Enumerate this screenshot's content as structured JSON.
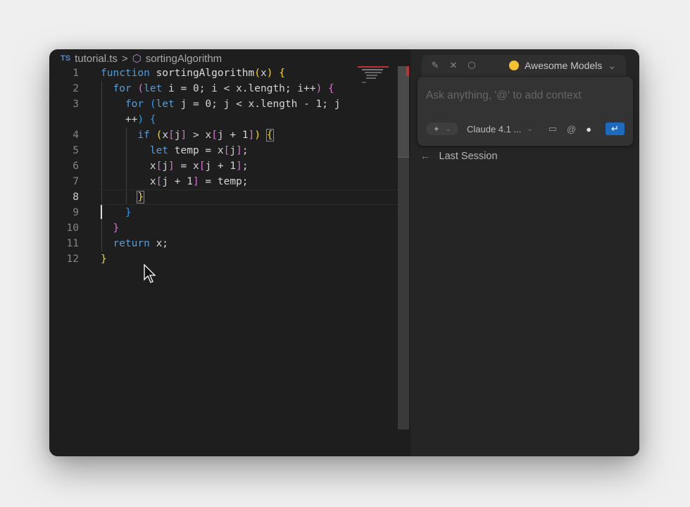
{
  "breadcrumb": {
    "lang_badge": "TS",
    "file": "tutorial.ts",
    "separator": ">",
    "symbol": "sortingAlgorithm"
  },
  "editor": {
    "current_line": 8,
    "lines": [
      {
        "n": "1",
        "tokens": [
          [
            "function ",
            "kw"
          ],
          [
            "sortingAlgorithm",
            "fn"
          ],
          [
            "(",
            "b1"
          ],
          [
            "x",
            ""
          ],
          [
            ")",
            "b1"
          ],
          [
            " ",
            ""
          ],
          [
            "{",
            "b1"
          ]
        ]
      },
      {
        "n": "2",
        "tokens": [
          [
            "  ",
            ""
          ],
          [
            "for ",
            "kw"
          ],
          [
            "(",
            "b2"
          ],
          [
            "let ",
            "kw"
          ],
          [
            "i = 0; i < x.length; i++",
            ""
          ],
          [
            ")",
            "b2"
          ],
          [
            " ",
            ""
          ],
          [
            "{",
            "b2"
          ]
        ]
      },
      {
        "n": "3",
        "tokens": [
          [
            "    ",
            ""
          ],
          [
            "for ",
            "kw"
          ],
          [
            "(",
            "b3"
          ],
          [
            "let ",
            "kw"
          ],
          [
            "j = 0; j < x.length - 1; j",
            ""
          ]
        ]
      },
      {
        "n": "",
        "tokens": [
          [
            "    ++",
            ""
          ],
          [
            ")",
            "b3"
          ],
          [
            " ",
            ""
          ],
          [
            "{",
            "b3"
          ]
        ]
      },
      {
        "n": "4",
        "tokens": [
          [
            "      ",
            ""
          ],
          [
            "if ",
            "kw"
          ],
          [
            "(",
            "b1"
          ],
          [
            "x",
            ""
          ],
          [
            "[",
            "b2"
          ],
          [
            "j",
            ""
          ],
          [
            "]",
            "b2"
          ],
          [
            " > x",
            ""
          ],
          [
            "[",
            "b2"
          ],
          [
            "j + 1",
            ""
          ],
          [
            "]",
            "b2"
          ],
          [
            ")",
            "b1"
          ],
          [
            " ",
            ""
          ],
          [
            "{",
            "b1 match"
          ]
        ]
      },
      {
        "n": "5",
        "tokens": [
          [
            "        ",
            ""
          ],
          [
            "let ",
            "kw"
          ],
          [
            "temp = x",
            ""
          ],
          [
            "[",
            "b2"
          ],
          [
            "j",
            ""
          ],
          [
            "]",
            "b2"
          ],
          [
            ";",
            ""
          ]
        ]
      },
      {
        "n": "6",
        "tokens": [
          [
            "        x",
            ""
          ],
          [
            "[",
            "b2"
          ],
          [
            "j",
            ""
          ],
          [
            "]",
            "b2"
          ],
          [
            " = x",
            ""
          ],
          [
            "[",
            "b2"
          ],
          [
            "j + 1",
            ""
          ],
          [
            "]",
            "b2"
          ],
          [
            ";",
            ""
          ]
        ]
      },
      {
        "n": "7",
        "tokens": [
          [
            "        x",
            ""
          ],
          [
            "[",
            "b2"
          ],
          [
            "j + 1",
            ""
          ],
          [
            "]",
            "b2"
          ],
          [
            " = temp;",
            ""
          ]
        ]
      },
      {
        "n": "8",
        "tokens": [
          [
            "      ",
            ""
          ],
          [
            "}",
            "b1 match"
          ]
        ]
      },
      {
        "n": "9",
        "tokens": [
          [
            "    ",
            ""
          ],
          [
            "}",
            "b3"
          ]
        ]
      },
      {
        "n": "10",
        "tokens": [
          [
            "  ",
            ""
          ],
          [
            "}",
            "b2"
          ]
        ]
      },
      {
        "n": "11",
        "tokens": [
          [
            "  ",
            ""
          ],
          [
            "return ",
            "kw"
          ],
          [
            "x;",
            ""
          ]
        ]
      },
      {
        "n": "12",
        "tokens": [
          [
            "}",
            "b1"
          ]
        ]
      }
    ]
  },
  "chat": {
    "models_label": "Awesome Models",
    "placeholder": "Ask anything, '@' to add context",
    "model": "Claude 4.1 ...",
    "last_session": "Last Session",
    "send_color": "#1c6bbf"
  }
}
